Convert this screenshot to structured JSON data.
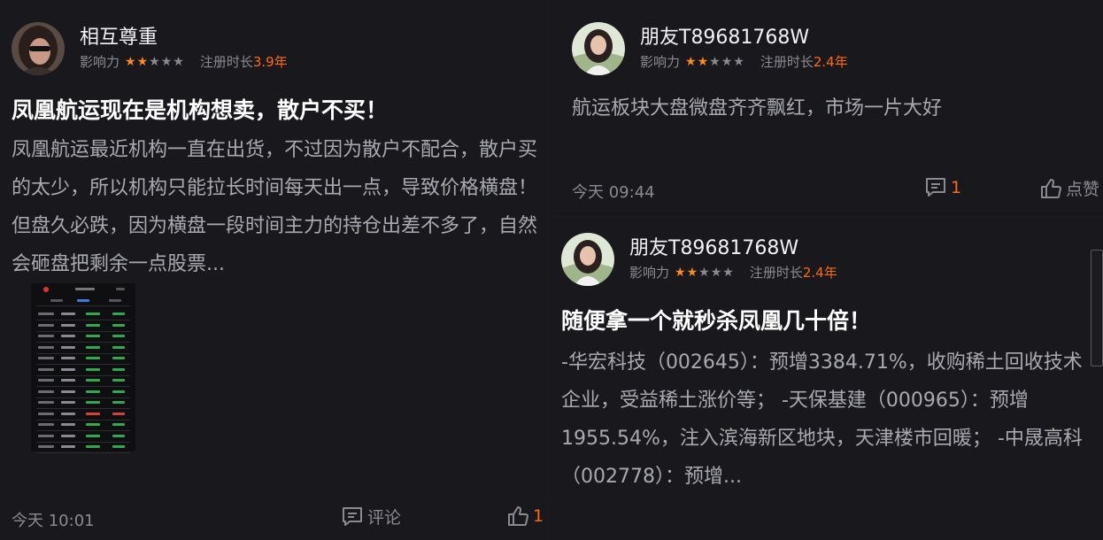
{
  "colors": {
    "accent": "#ff6a13",
    "star_on": "#ff8a1f",
    "star_off": "#8a8a92"
  },
  "posts": [
    {
      "author": "相互尊重",
      "influence_label": "影响力",
      "influence_stars": 2,
      "influence_max": 5,
      "reg_label": "注册时长",
      "reg_value": "3.9年",
      "title": "凤凰航运现在是机构想卖，散户不买！",
      "body": "凤凰航运最近机构一直在出货，不过因为散户不配合，散户买的太少，所以机构只能拉长时间每天出一点，导致价格横盘！但盘久必跌，因为横盘一段时间主力的持仓出差不多了，自然会砸盘把剩余一点股票...",
      "time": "今天 10:01",
      "comment_label": "评论",
      "like_label": "1",
      "has_image": true
    },
    {
      "author": "朋友T89681768W",
      "influence_label": "影响力",
      "influence_stars": 2,
      "influence_max": 5,
      "reg_label": "注册时长",
      "reg_value": "2.4年",
      "body": "航运板块大盘微盘齐齐飘红，市场一片大好",
      "time": "今天 09:44",
      "comment_label": "1",
      "like_label": "点赞"
    },
    {
      "author": "朋友T89681768W",
      "influence_label": "影响力",
      "influence_stars": 2,
      "influence_max": 5,
      "reg_label": "注册时长",
      "reg_value": "2.4年",
      "title": "随便拿一个就秒杀凤凰几十倍！",
      "body": "-华宏科技（002645）：预增3384.71%，收购稀土回收技术企业，受益稀土涨价等； -天保基建（000965）：预增1955.54%，注入滨海新区地块，天津楼市回暖； -中晟高科（002778）：预增..."
    }
  ]
}
